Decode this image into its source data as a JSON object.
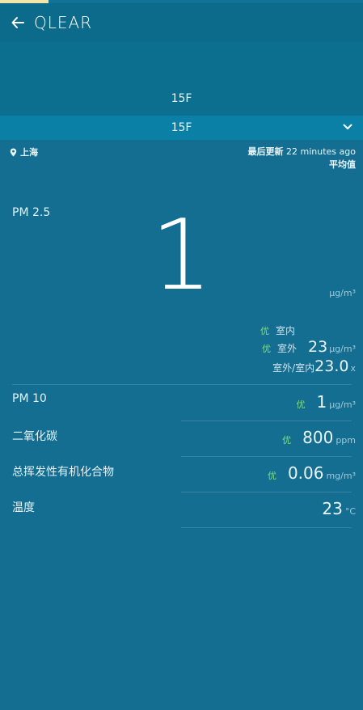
{
  "appbar": {
    "title": "QLEAR"
  },
  "floor": {
    "label": "15F",
    "selected": "15F"
  },
  "location": {
    "city": "上海"
  },
  "update": {
    "label": "最后更新",
    "time": "22 minutes ago",
    "mode": "平均值"
  },
  "pm25": {
    "label": "PM 2.5",
    "value": "1",
    "unit": "μg/m³",
    "indoor": {
      "quality": "优",
      "label": "室内"
    },
    "outdoor": {
      "quality": "优",
      "label": "室外",
      "value": "23",
      "unit": "μg/m³"
    },
    "ratio": {
      "label": "室外/室内",
      "value": "23.0",
      "unit": "x"
    }
  },
  "metrics": [
    {
      "name": "PM 10",
      "quality": "优",
      "value": "1",
      "unit": "μg/m³"
    },
    {
      "name": "二氧化碳",
      "quality": "优",
      "value": "800",
      "unit": "ppm"
    },
    {
      "name": "总挥发性有机化合物",
      "quality": "优",
      "value": "0.06",
      "unit": "mg/m³"
    },
    {
      "name": "温度",
      "quality": "",
      "value": "23",
      "unit": "°C"
    }
  ],
  "colors": {
    "background": "#136e92",
    "appbar": "#0c6b8b",
    "selector": "#0b80a6",
    "good": "#7fe07a"
  }
}
